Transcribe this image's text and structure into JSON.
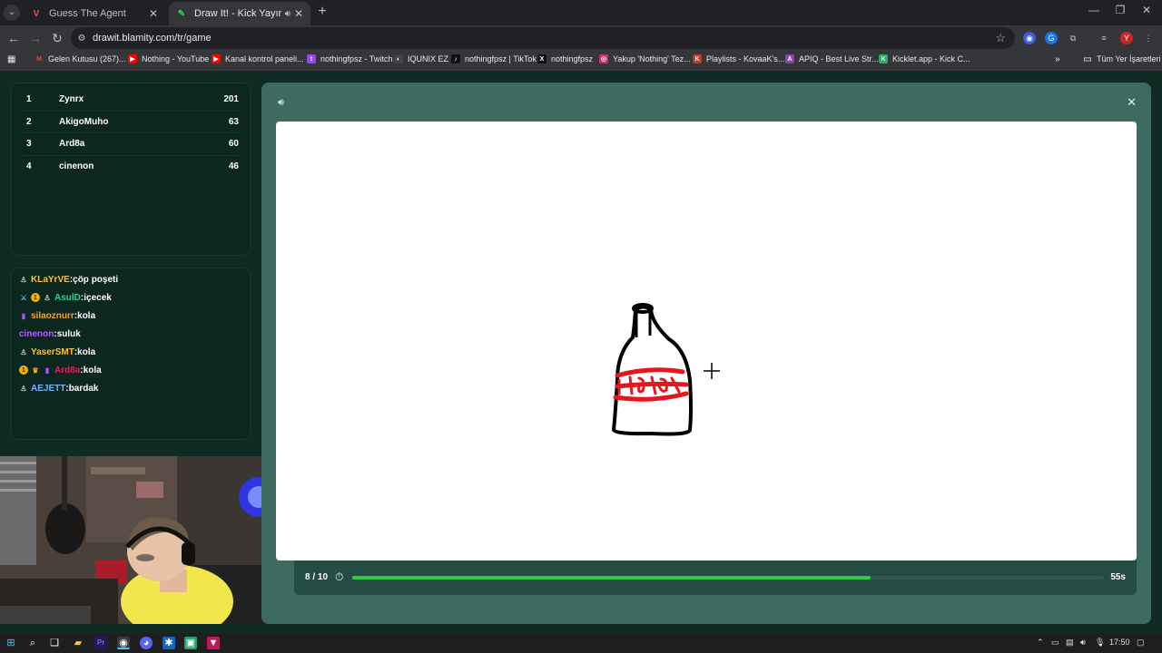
{
  "browser": {
    "tabs": [
      {
        "title": "Guess The Agent",
        "active": false
      },
      {
        "title": "Draw It! - Kick Yayınları İçin",
        "active": true
      }
    ],
    "url": "drawit.blamity.com/tr/game",
    "bookmarks": [
      {
        "label": "Gelen Kutusu (267)...",
        "icon": "gmail-icon",
        "color": "#ea4335"
      },
      {
        "label": "Nothing - YouTube",
        "icon": "youtube-icon",
        "color": "#ff0000"
      },
      {
        "label": "Kanal kontrol paneli...",
        "icon": "youtube-icon",
        "color": "#ff0000"
      },
      {
        "label": "nothingfpsz - Twitch",
        "icon": "twitch-icon",
        "color": "#9146ff"
      },
      {
        "label": "IQUNIX EZ",
        "icon": "iqunix-icon",
        "color": "#333333"
      },
      {
        "label": "nothingfpsz | TikTok",
        "icon": "tiktok-icon",
        "color": "#000000"
      },
      {
        "label": "nothingfpsz",
        "icon": "x-icon",
        "color": "#000000"
      },
      {
        "label": "Yakup 'Nothing' Tez...",
        "icon": "instagram-icon",
        "color": "#d62976"
      },
      {
        "label": "Playlists - KovaaK's...",
        "icon": "kovaaks-icon",
        "color": "#c0392b"
      },
      {
        "label": "APIQ - Best Live Str...",
        "icon": "apiq-icon",
        "color": "#8e44ad"
      },
      {
        "label": "Kicklet.app - Kick C...",
        "icon": "kicklet-icon",
        "color": "#27ae60"
      }
    ],
    "all_bookmarks_label": "Tüm Yer İşaretleri",
    "profile_initial": "Y"
  },
  "leaderboard": [
    {
      "rank": "1",
      "name": "Zynrx",
      "score": "201"
    },
    {
      "rank": "2",
      "name": "AkigoMuho",
      "score": "63"
    },
    {
      "rank": "3",
      "name": "Ard8a",
      "score": "60"
    },
    {
      "rank": "4",
      "name": "cinenon",
      "score": "46"
    }
  ],
  "chat": [
    {
      "user": "KLaYrVE",
      "user_color": "#f5c542",
      "text": "çöp poşeti",
      "badges": [
        "pawn-icon"
      ]
    },
    {
      "user": "AsulD",
      "user_color": "#2ecc9a",
      "text": "içecek",
      "badges": [
        "sword-icon",
        "sub-one-icon",
        "pawn-icon"
      ]
    },
    {
      "user": "silaoznurr",
      "user_color": "#f5a623",
      "text": "kola",
      "badges": [
        "ptag-icon"
      ]
    },
    {
      "user": "cinenon",
      "user_color": "#b45cff",
      "text": "suluk",
      "badges": []
    },
    {
      "user": "YaserSMT",
      "user_color": "#f5c542",
      "text": "kola",
      "badges": [
        "pawn-icon"
      ]
    },
    {
      "user": "Ard8a",
      "user_color": "#e0245e",
      "text": "kola",
      "badges": [
        "sub-one-icon",
        "crown-icon",
        "ptag-icon"
      ]
    },
    {
      "user": "AEJETT",
      "user_color": "#6fb7ff",
      "text": "bardak",
      "badges": [
        "pawn-icon"
      ]
    }
  ],
  "game": {
    "round": "8 / 10",
    "seconds_left": "55s",
    "time_progress": 0.69
  },
  "taskbar": {
    "time": "17:50"
  },
  "colors": {
    "page_bg": "#0f2b24",
    "panel_bg": "#0c2620",
    "game_bg": "#3d6b62",
    "progress_fill": "#2ecc40",
    "drawing_red": "#e8141e"
  }
}
